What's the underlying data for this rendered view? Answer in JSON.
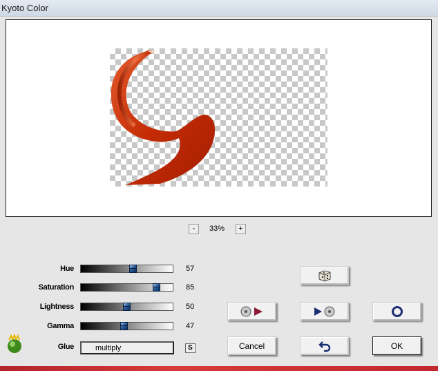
{
  "window": {
    "title": "Kyoto Color"
  },
  "zoom": {
    "minus_label": "-",
    "value": "33%",
    "plus_label": "+"
  },
  "sliders": [
    {
      "label": "Hue",
      "value": "57",
      "level": 0.57
    },
    {
      "label": "Saturation",
      "value": "85",
      "level": 0.85
    },
    {
      "label": "Lightness",
      "value": "50",
      "level": 0.5
    },
    {
      "label": "Gamma",
      "value": "47",
      "level": 0.47
    }
  ],
  "glue": {
    "label": "Glue",
    "value": "multiply",
    "s_button": "S"
  },
  "buttons": {
    "random": "dice-icon",
    "load_preset": "disc-arrow-icon",
    "save_preset": "arrow-disc-icon",
    "reset": "circle-icon",
    "cancel": "Cancel",
    "undo": "undo-arrow-icon",
    "ok": "OK"
  },
  "colors": {
    "thumb": "#2a5d9b",
    "accent_red": "#c0272e",
    "shape_red": "#c8300b"
  }
}
